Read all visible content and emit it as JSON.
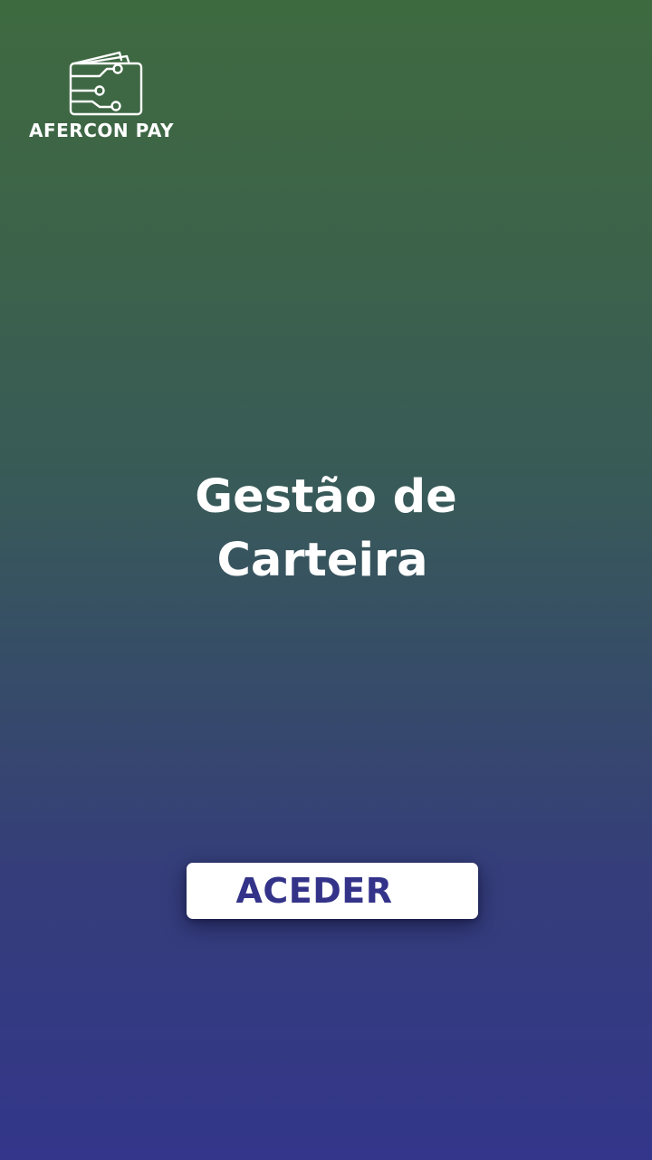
{
  "brand": {
    "name": "AFERCON PAY",
    "logo_icon": "wallet-circuit-icon"
  },
  "headline": {
    "line1": "Gestão de",
    "line2": "Carteira"
  },
  "cta": {
    "label": "ACEDER"
  },
  "colors": {
    "gradient_top": "#3e6a40",
    "gradient_bottom": "#33368a",
    "button_text": "#34338a",
    "button_bg": "#ffffff"
  }
}
